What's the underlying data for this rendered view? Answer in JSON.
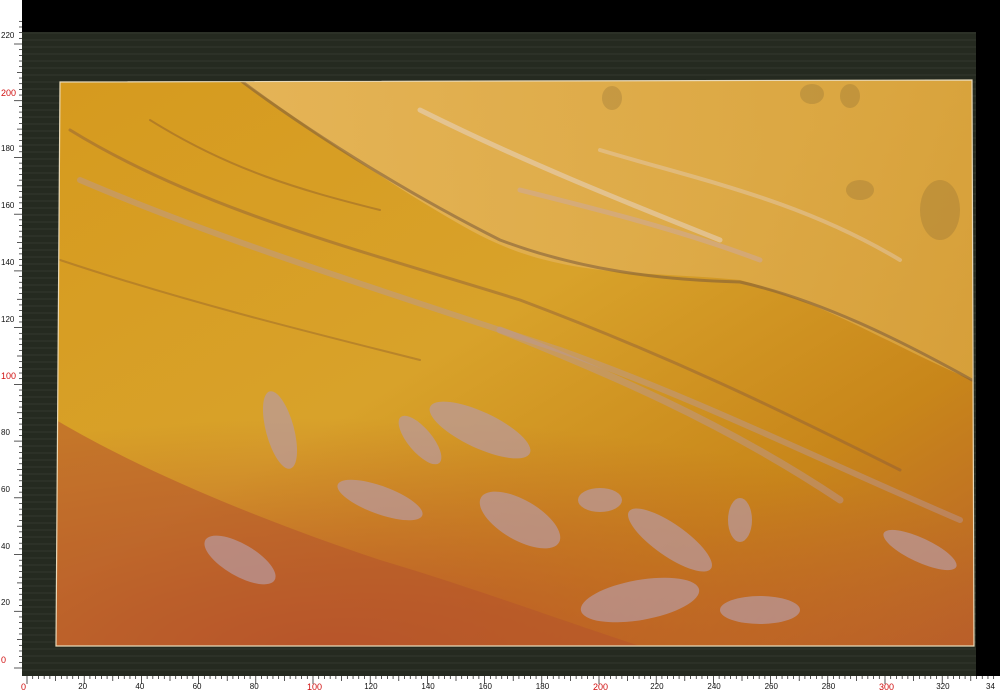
{
  "scale": {
    "y_ticks": [
      "0",
      "20",
      "40",
      "60",
      "80",
      "100",
      "120",
      "140",
      "160",
      "180",
      "200",
      "220"
    ],
    "x_ticks": [
      "0",
      "20",
      "40",
      "60",
      "80",
      "100",
      "120",
      "140",
      "160",
      "180",
      "200",
      "220",
      "240",
      "260",
      "280",
      "300",
      "320",
      "34"
    ],
    "highlight_values": [
      "0",
      "100",
      "200",
      "300"
    ],
    "highlight_color": "#d01010"
  },
  "palette": {
    "backdrop": "#252a20",
    "slab_gold": "#d69a1e",
    "slab_amber": "#c8861a",
    "slab_rust": "#b9502a",
    "vein_lilac": "#b99aa0"
  }
}
